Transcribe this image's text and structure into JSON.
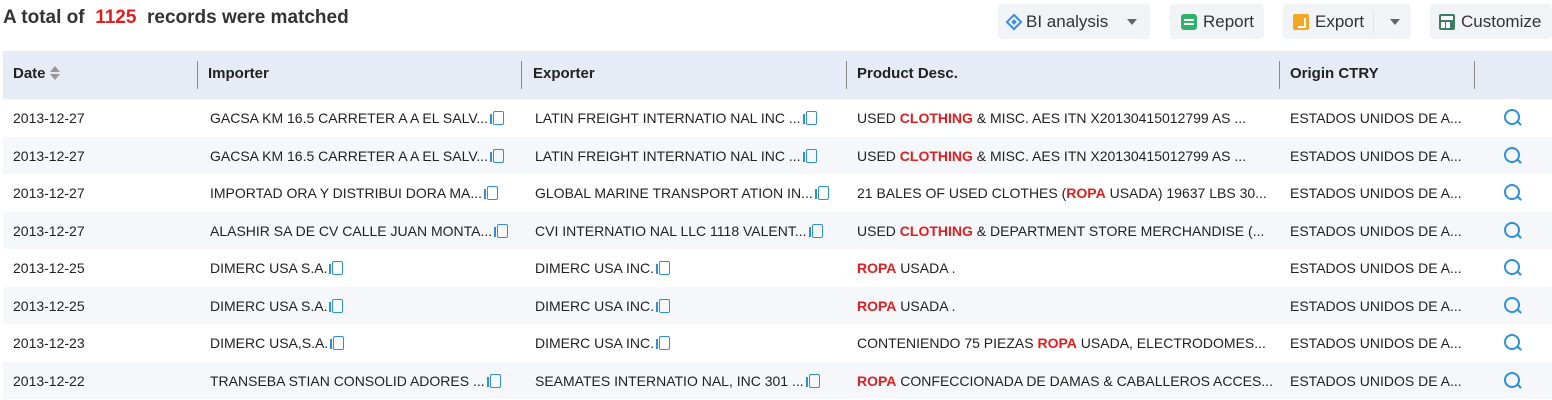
{
  "summary": {
    "prefix": "A total of",
    "count": "1125",
    "suffix": "records were matched"
  },
  "toolbar": {
    "bi_label": "BI analysis",
    "report_label": "Report",
    "export_label": "Export",
    "customize_label": "Customize"
  },
  "columns": {
    "date": "Date",
    "importer": "Importer",
    "exporter": "Exporter",
    "product": "Product Desc.",
    "origin": "Origin CTRY"
  },
  "colors": {
    "highlight": "#e02020",
    "accent": "#2f8fd8",
    "header_bg": "#e6ebf6"
  },
  "rows": [
    {
      "date": "2013-12-27",
      "importer": "GACSA KM 16.5 CARRETER A A EL SALV...",
      "exporter": "LATIN FREIGHT INTERNATIO NAL INC ...",
      "product_pre": "USED ",
      "product_hl": "CLOTHING",
      "product_post": " & MISC. AES ITN X20130415012799 AS ...",
      "origin": "ESTADOS UNIDOS DE A..."
    },
    {
      "date": "2013-12-27",
      "importer": "GACSA KM 16.5 CARRETER A A EL SALV...",
      "exporter": "LATIN FREIGHT INTERNATIO NAL INC ...",
      "product_pre": "USED ",
      "product_hl": "CLOTHING",
      "product_post": " & MISC. AES ITN X20130415012799 AS ...",
      "origin": "ESTADOS UNIDOS DE A..."
    },
    {
      "date": "2013-12-27",
      "importer": "IMPORTAD ORA Y DISTRIBUI DORA MA...",
      "exporter": "GLOBAL MARINE TRANSPORT ATION IN...",
      "product_pre": "21 BALES OF USED CLOTHES (",
      "product_hl": "ROPA",
      "product_post": " USADA) 19637 LBS 30...",
      "origin": "ESTADOS UNIDOS DE A..."
    },
    {
      "date": "2013-12-27",
      "importer": "ALASHIR SA DE CV CALLE JUAN MONTA...",
      "exporter": "CVI INTERNATIO NAL LLC 1118 VALENT...",
      "product_pre": "USED ",
      "product_hl": "CLOTHING",
      "product_post": " & DEPARTMENT STORE MERCHANDISE (...",
      "origin": "ESTADOS UNIDOS DE A..."
    },
    {
      "date": "2013-12-25",
      "importer": "DIMERC USA S.A.",
      "exporter": "DIMERC USA INC.",
      "product_pre": "",
      "product_hl": "ROPA",
      "product_post": " USADA .",
      "origin": "ESTADOS UNIDOS DE A..."
    },
    {
      "date": "2013-12-25",
      "importer": "DIMERC USA S.A.",
      "exporter": "DIMERC USA INC.",
      "product_pre": "",
      "product_hl": "ROPA",
      "product_post": " USADA .",
      "origin": "ESTADOS UNIDOS DE A..."
    },
    {
      "date": "2013-12-23",
      "importer": "DIMERC USA,S.A.",
      "exporter": "DIMERC USA INC.",
      "product_pre": "CONTENIENDO 75 PIEZAS ",
      "product_hl": "ROPA",
      "product_post": " USADA, ELECTRODOMES...",
      "origin": "ESTADOS UNIDOS DE A..."
    },
    {
      "date": "2013-12-22",
      "importer": "TRANSEBA STIAN CONSOLID ADORES ...",
      "exporter": "SEAMATES INTERNATIO NAL, INC 301 ...",
      "product_pre": "",
      "product_hl": "ROPA",
      "product_post": " CONFECCIONADA DE DAMAS & CABALLEROS ACCES...",
      "origin": "ESTADOS UNIDOS DE A..."
    }
  ]
}
